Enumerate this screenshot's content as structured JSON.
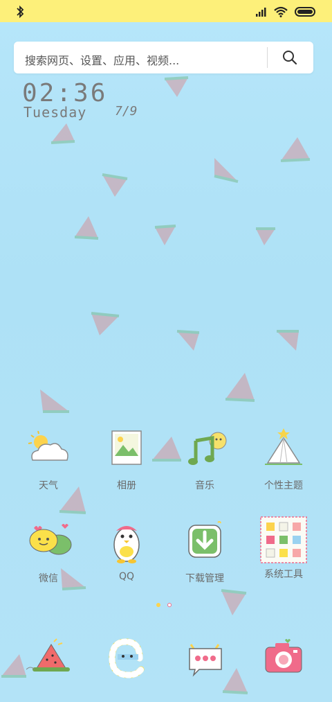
{
  "status_bar": {
    "icons": [
      "bluetooth-icon",
      "signal-icon",
      "wifi-icon",
      "battery-icon"
    ]
  },
  "search": {
    "placeholder": "搜索网页、设置、应用、视频..."
  },
  "clock": {
    "time": "02:36",
    "day": "Tuesday",
    "date": "7/9"
  },
  "apps_row1": [
    {
      "label": "天气",
      "icon": "weather-cloud-icon"
    },
    {
      "label": "相册",
      "icon": "photo-album-icon"
    },
    {
      "label": "音乐",
      "icon": "music-note-icon"
    },
    {
      "label": "个性主题",
      "icon": "theme-tent-icon"
    }
  ],
  "apps_row2": [
    {
      "label": "微信",
      "icon": "wechat-icon"
    },
    {
      "label": "QQ",
      "icon": "qq-penguin-icon"
    },
    {
      "label": "下载管理",
      "icon": "download-arrow-icon"
    },
    {
      "label": "系统工具",
      "icon": "system-tools-folder-icon"
    }
  ],
  "page_indicator": {
    "count": 2,
    "active": 1
  },
  "dock": [
    {
      "icon": "watermelon-icon"
    },
    {
      "icon": "browser-e-icon"
    },
    {
      "icon": "message-bubble-icon"
    },
    {
      "icon": "camera-icon"
    }
  ],
  "colors": {
    "status_bar": "#fdf07a",
    "background": "#b3e3f7",
    "label": "#6a6a6a",
    "clock": "#7a7a7a"
  }
}
